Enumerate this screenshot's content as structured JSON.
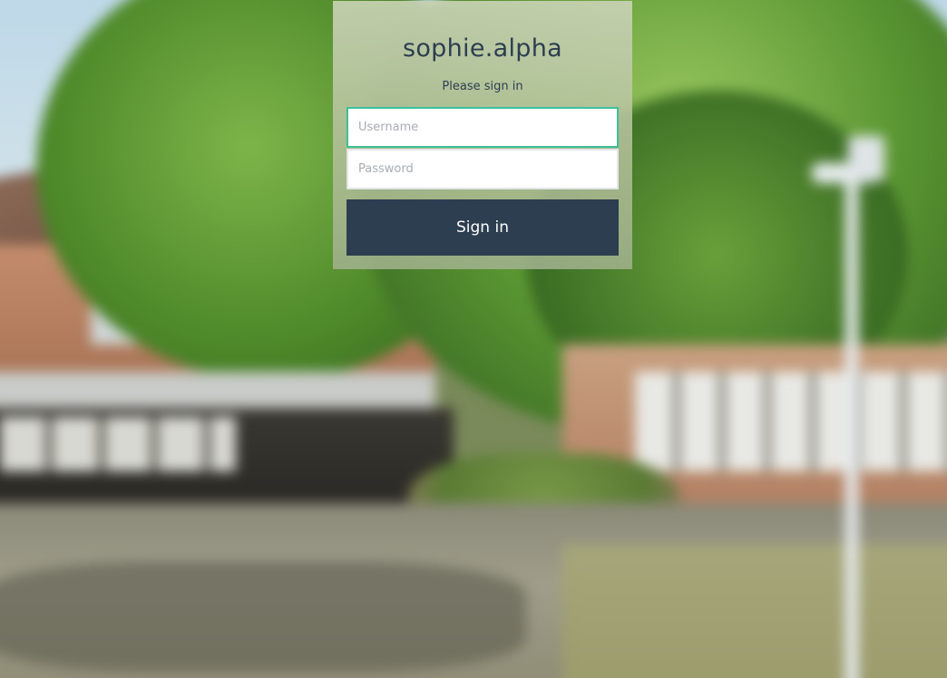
{
  "login": {
    "title": "sophie.alpha",
    "subtitle": "Please sign in",
    "username_placeholder": "Username",
    "password_placeholder": "Password",
    "signin_label": "Sign in"
  },
  "colors": {
    "primary": "#2c3e50",
    "focus_border": "#3fbf9a"
  }
}
